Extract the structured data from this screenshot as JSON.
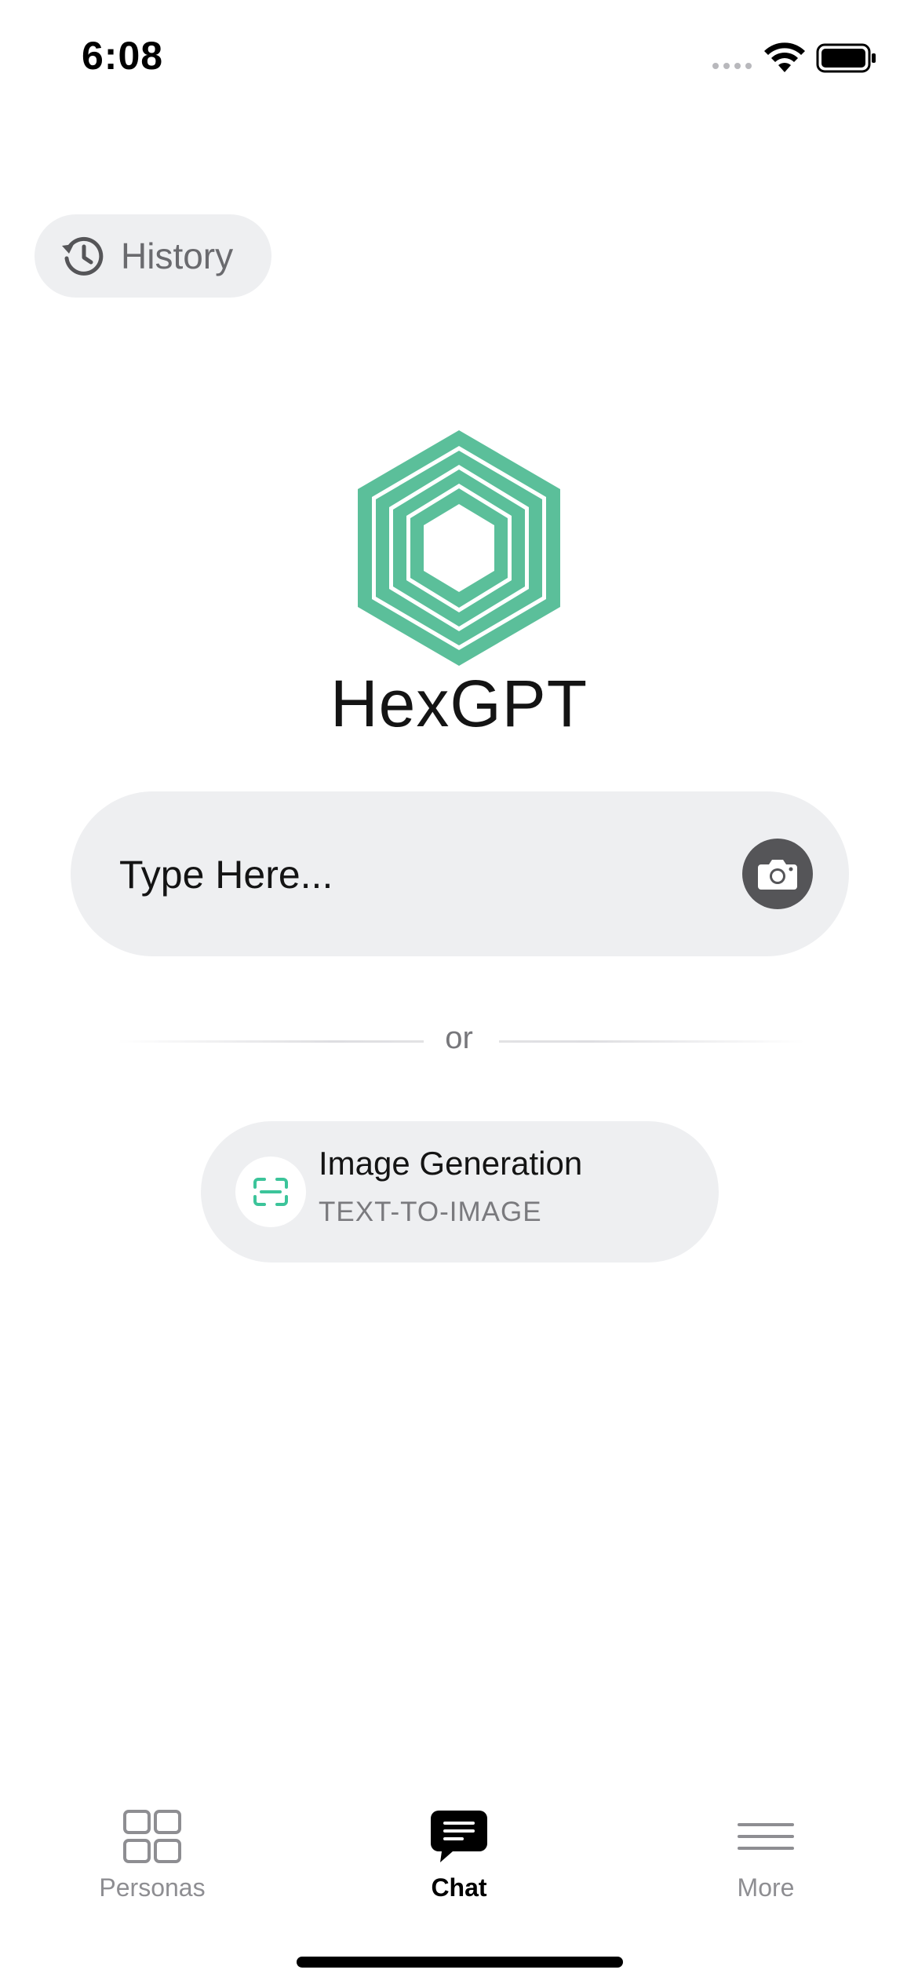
{
  "status_bar": {
    "time": "6:08"
  },
  "header": {
    "history_label": "History",
    "history_icon": "history-clock-icon"
  },
  "logo": {
    "text": "HexGPT",
    "color": "#5bbf9a"
  },
  "chat_input": {
    "placeholder": "Type Here...",
    "value": "",
    "camera_icon": "camera-icon"
  },
  "divider": {
    "text": "or"
  },
  "image_generation": {
    "title": "Image Generation",
    "subtitle": "TEXT-TO-IMAGE",
    "icon": "scan-frame-icon",
    "icon_color": "#3cc49a"
  },
  "tab_bar": {
    "selected": "Chat",
    "tabs": [
      {
        "label": "Personas",
        "icon": "grid-icon"
      },
      {
        "label": "Chat",
        "icon": "chat-bubble-icon"
      },
      {
        "label": "More",
        "icon": "menu-lines-icon"
      }
    ]
  }
}
